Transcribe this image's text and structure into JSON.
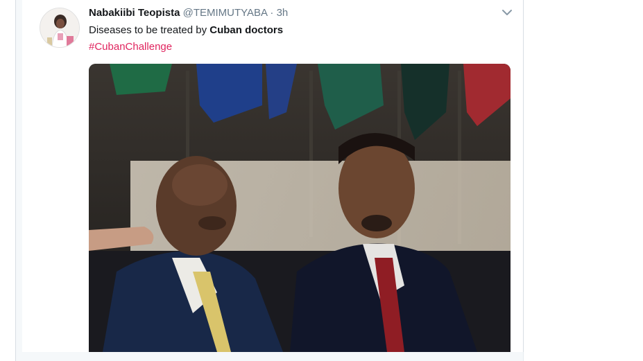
{
  "tweet": {
    "display_name": "Nabakiibi Teopista",
    "handle": "@TEMIMUTYABA",
    "separator": "·",
    "time": "3h",
    "text_plain": "Diseases to be treated by ",
    "text_bold": "Cuban doctors",
    "hashtag": "#CubanChallenge"
  },
  "icons": {
    "avatar": "user-avatar-photo",
    "more": "chevron-down-icon"
  },
  "colors": {
    "hashtag": "#e0245e",
    "secondary_text": "#657786",
    "primary_text": "#14171a"
  }
}
